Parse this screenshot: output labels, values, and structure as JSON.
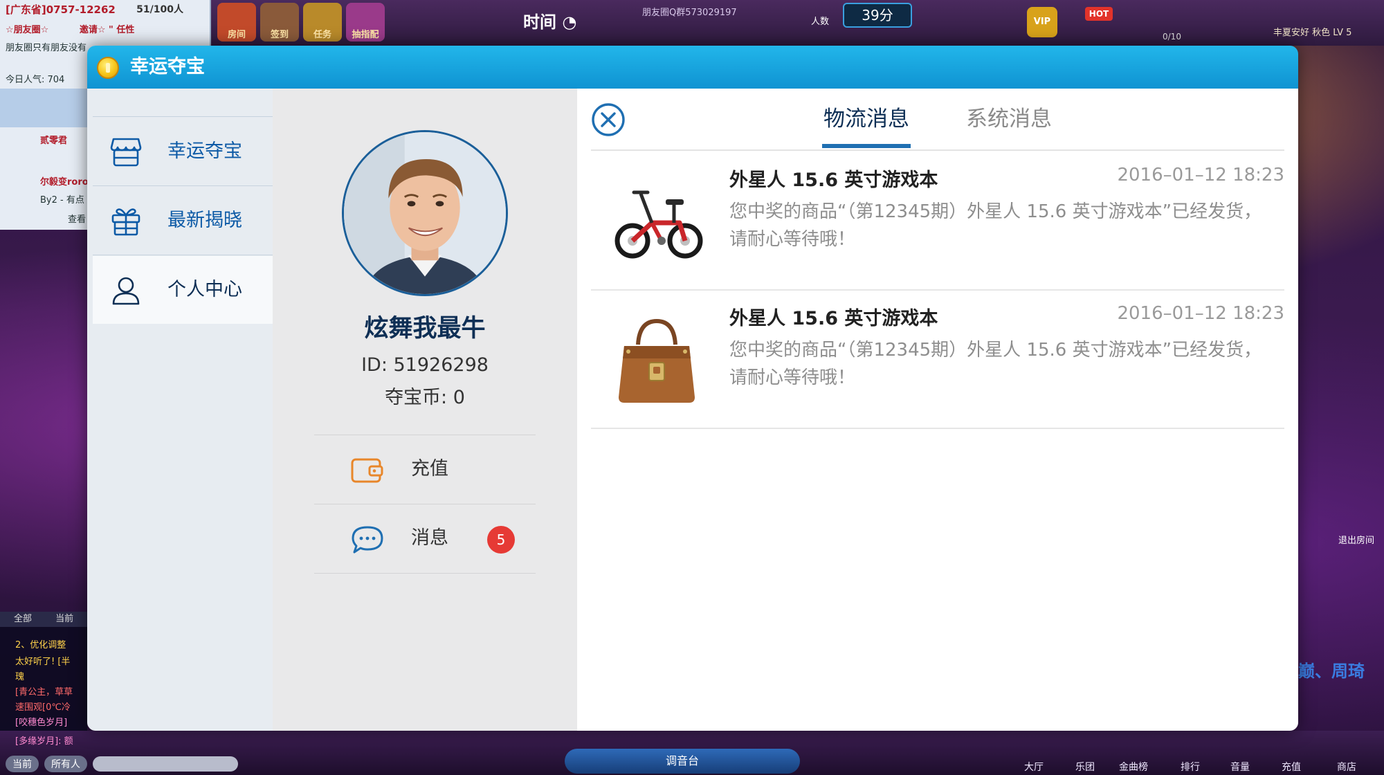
{
  "background": {
    "room": {
      "title": "[广东省]0757-12262",
      "count": "51/100人",
      "tagline": "☆朋友圈☆",
      "invite": "邀请☆ \" 任性",
      "desc": "朋友圈只有朋友没有",
      "popularity": "今日人气: 704",
      "members": [
        "贰零君",
        "尔毅变roro",
        "By2 - 有点"
      ],
      "view_more": "查看"
    },
    "header_icons": [
      "房间",
      "签到",
      "任务",
      "抽指配"
    ],
    "timer_label": "时间",
    "qq_group": "朋友圈Q群573029197",
    "score": "39分",
    "people_label": "人数",
    "vip_labels": [
      "VIP",
      "HOT"
    ],
    "user_level": "丰夏安好 秋色  LV 5",
    "slot_count": "0/10",
    "chat": {
      "tabs": [
        "全部",
        "当前"
      ],
      "lines": [
        "2、优化调整",
        "太好听了! [半",
        "瑰",
        "[青公主，草草",
        "速围观[0℃冷",
        "[咬穗色岁月]",
        "[多缘岁月]: 额"
      ]
    },
    "input_controls": [
      "当前",
      "所有人"
    ],
    "bottom_mid": "调音台",
    "bottom_items": [
      "大厅",
      "乐团",
      "金曲榜",
      "排行",
      "音量",
      "充值",
      "商店"
    ],
    "side_text": "巅、周琦",
    "exit_room": "退出房间"
  },
  "modal": {
    "title": "幸运夺宝",
    "nav": [
      {
        "label": "幸运夺宝",
        "icon": "store-icon",
        "active": false
      },
      {
        "label": "最新揭晓",
        "icon": "gift-icon",
        "active": false
      },
      {
        "label": "个人中心",
        "icon": "user-icon",
        "active": true
      }
    ],
    "profile": {
      "nickname": "炫舞我最牛",
      "id": "ID: 51926298",
      "coins": "夺宝币: 0",
      "recharge_label": "充值",
      "messages_label": "消息",
      "messages_badge": "5"
    },
    "messages": {
      "tabs": [
        {
          "label": "物流消息",
          "active": true
        },
        {
          "label": "系统消息",
          "active": false
        }
      ],
      "items": [
        {
          "title": "外星人 15.6 英寸游戏本",
          "time": "2016–01–12 18:23",
          "body": "您中奖的商品“（第12345期）外星人 15.6 英寸游戏本”已经发货，请耐心等待哦！",
          "thumb": "bicycle-image"
        },
        {
          "title": "外星人 15.6 英寸游戏本",
          "time": "2016–01–12 18:23",
          "body": "您中奖的商品“（第12345期）外星人 15.6 英寸游戏本”已经发货，请耐心等待哦！",
          "thumb": "handbag-image"
        }
      ]
    }
  },
  "colors": {
    "title_bar": "#1aa7e2",
    "nav_text": "#0d5aa6",
    "dark_text": "#0e2f55",
    "badge": "#e63a35",
    "recharge_icon": "#e8862a",
    "message_icon": "#1f6fb2"
  }
}
